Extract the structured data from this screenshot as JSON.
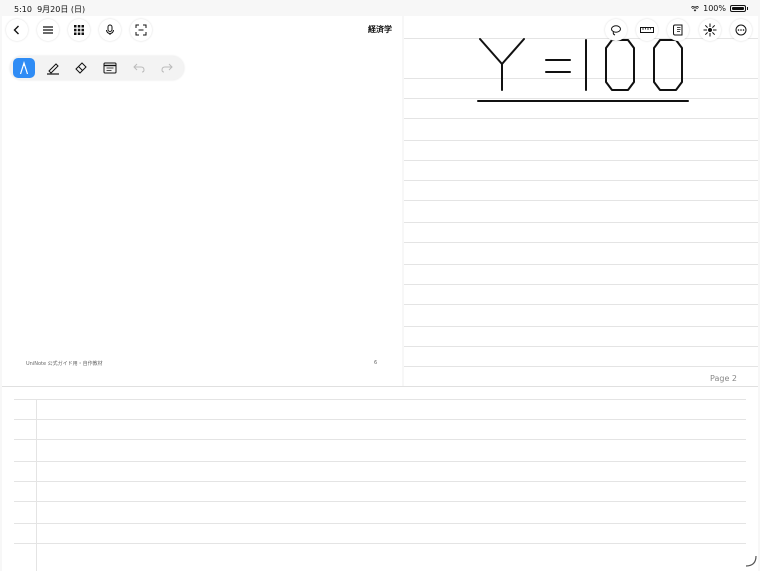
{
  "status": {
    "time": "5:10",
    "date": "9月20日 (日)",
    "battery": "100%"
  },
  "document": {
    "title": "経済学"
  },
  "page_left": {
    "footer": "UniNote 公式ガイド用・自作教材",
    "page_number": "6"
  },
  "page_right": {
    "label": "Page 2",
    "handwritten_equation": "Y=100"
  },
  "icons": {
    "back": "chevron-left-icon",
    "menu": "hamburger-icon",
    "grid": "grid-icon",
    "mic": "microphone-icon",
    "scan": "scan-icon",
    "lasso": "lasso-icon",
    "ruler": "ruler-icon",
    "book": "book-icon",
    "laser": "laser-pointer-icon",
    "more": "more-icon",
    "pen": "pen-icon",
    "highlighter": "highlighter-icon",
    "eraser": "eraser-icon",
    "text": "text-box-icon",
    "undo": "undo-icon",
    "redo": "redo-icon"
  },
  "colors": {
    "accent": "#2f8cf5"
  }
}
